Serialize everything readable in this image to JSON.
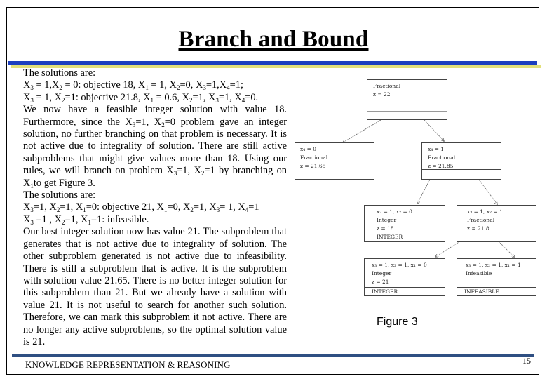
{
  "slide": {
    "title": "Branch and Bound",
    "page_number": "15",
    "footer": "KNOWLEDGE REPRESENTATION & REASONING",
    "colors": {
      "title_bar_blue": "#1c3fbf",
      "title_bar_yellow": "#e3e07a",
      "footer_rule": "#2f4f82"
    }
  },
  "body": {
    "intro1": "The solutions are:",
    "line1": {
      "a": "X",
      "a_sub": "3",
      "b": " = 1,X",
      "b_sub": "2",
      "c": " = 0: objective 18, X",
      "c_sub": "1",
      "d": " = 1, X",
      "d_sub": "2",
      "e": "=0, X",
      "e_sub": "3",
      "f": "=1,X",
      "f_sub": "4",
      "g": "=1;"
    },
    "line2": {
      "a": "X",
      "a_sub": "3",
      "b": " = 1, X",
      "b_sub": "2",
      "c": "=1: objective 21.8, X",
      "c_sub": "1",
      "d": " = 0.6, X",
      "d_sub": "2",
      "e": "=1, X",
      "e_sub": "3",
      "f": "=1, X",
      "f_sub": "4",
      "g": "=0."
    },
    "para1_start": "We now have a feasible integer solution with value 18. Furthermore, since the X",
    "para1_sub1": "3",
    "para1_mid1": "=1, X",
    "para1_sub2": "2",
    "para1_mid2": "=0 problem gave an integer solution, no further branching on that problem is necessary. It is not active due to integrality of solution. There are still active subproblems that might give values more than 18. Using our rules, we will branch on problem X",
    "para1_sub3": "3",
    "para1_mid3": "=1, X",
    "para1_sub4": "2",
    "para1_mid4": "=1 by branching on X",
    "para1_sub5": "1",
    "para1_end": "to get Figure 3.",
    "intro2": "The solutions are:",
    "line3": {
      "a": "X",
      "a_sub": "3",
      "b": "=1, X",
      "b_sub": "2",
      "c": "=1, X",
      "c_sub": "1",
      "d": "=0: objective 21, X",
      "d_sub": "1",
      "e": "=0, X",
      "e_sub": "2",
      "f": "=1, X",
      "f_sub": "3",
      "g": "= 1, X",
      "g_sub": "4",
      "h": "=1"
    },
    "line4": {
      "a": "X",
      "a_sub": "3",
      "b": " =1 , X",
      "b_sub": "2",
      "c": "=1, X",
      "c_sub": "1",
      "d": "=1: infeasible."
    },
    "para2": "Our best integer solution now has value 21. The subproblem that generates that is not active due to integrality of solution. The other subproblem generated is not active due to infeasibility. There is still a subproblem that is active. It is the subproblem with solution value 21.65. There is no better integer solution for this subproblem than 21. But we already have a solution with value 21. It is not useful to search for another such solution. Therefore, we can mark this subproblem it not active. There are no longer any active subproblems, so the optimal solution value is 21."
  },
  "figure": {
    "caption": "Figure 3",
    "nodes": [
      {
        "id": "root",
        "lines": [
          "Fractional",
          "z = 22"
        ],
        "status": ""
      },
      {
        "id": "x4_0",
        "lines": [
          "x₄ = 0",
          "Fractional",
          "z = 21.65"
        ],
        "status": null
      },
      {
        "id": "x4_1",
        "lines": [
          "x₄ = 1",
          "Fractional",
          "z = 21.85"
        ],
        "status": ""
      },
      {
        "id": "x3_1_x2_0",
        "lines": [
          "x₃ = 1, x₂ = 0",
          "Integer",
          "z = 18",
          "INTEGER"
        ],
        "status": null
      },
      {
        "id": "x3_1_x2_1",
        "lines": [
          "x₃ = 1, x₂ = 1",
          "Fractional",
          "z = 21.8"
        ],
        "status": null
      },
      {
        "id": "x1_0",
        "lines": [
          "x₃ = 1, x₂ = 1, x₁ = 0",
          "Integer",
          "z = 21"
        ],
        "status": "INTEGER"
      },
      {
        "id": "x1_1",
        "lines": [
          "x₃ = 1, x₂ = 1, x₁ = 1",
          "Infeasible"
        ],
        "status": "INFEASIBLE"
      }
    ]
  }
}
